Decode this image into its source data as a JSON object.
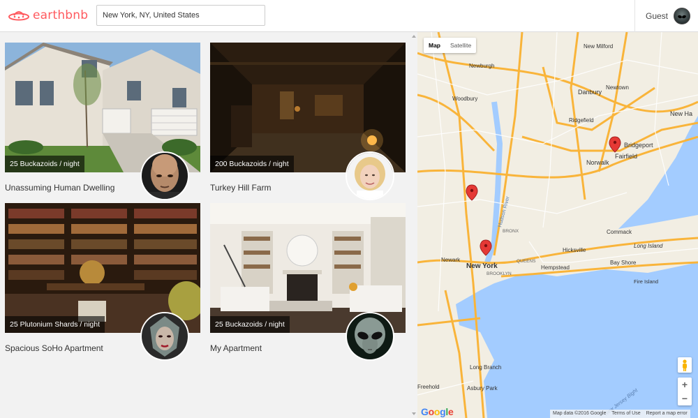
{
  "header": {
    "logo_text": "earthbnb",
    "search_value": "New York, NY, United States",
    "user_name": "Guest"
  },
  "listings": [
    {
      "price": "25 Buckazoids / night",
      "title": "Unassuming Human Dwelling",
      "photo": "house-photo",
      "host": "bald-alien-host"
    },
    {
      "price": "200 Buckazoids / night",
      "title": "Turkey Hill Farm",
      "photo": "dark-farm-interior-photo",
      "host": "blonde-woman-host"
    },
    {
      "price": "25 Plutonium Shards / night",
      "title": "Spacious SoHo Apartment",
      "photo": "library-photo",
      "host": "green-alien-host"
    },
    {
      "price": "25 Buckazoids / night",
      "title": "My Apartment",
      "photo": "living-room-photo",
      "host": "grey-alien-host"
    }
  ],
  "map": {
    "type_buttons": [
      "Map",
      "Satellite"
    ],
    "active_type": "Map",
    "zoom_in": "+",
    "zoom_out": "−",
    "attribution": [
      "Map data ©2016 Google",
      "Terms of Use",
      "Report a map error"
    ],
    "labels": {
      "new_milford": "New Milford",
      "newburgh": "Newburgh",
      "danbury": "Danbury",
      "newtown": "Newtown",
      "woodbury": "Woodbury",
      "ridgefield": "Ridgefield",
      "new_haven": "New Ha",
      "bridgeport": "Bridgeport",
      "norwalk": "Norwalk",
      "fairfield": "Fairfield",
      "hudson_river": "Hudson River",
      "bronx": "BRONX",
      "commack": "Commack",
      "newark": "Newark",
      "new_york": "New York",
      "queens": "QUEENS",
      "hicksville": "Hicksville",
      "long_island": "Long Island",
      "hempstead": "Hempstead",
      "bay_shore": "Bay Shore",
      "brooklyn": "BROOKLYN",
      "fire_island": "Fire Island",
      "long_branch": "Long Branch",
      "asbury_park": "Asbury Park",
      "freehold": "Freehold",
      "new_jersey_bight": "New Jersey Bight"
    },
    "colors": {
      "land": "#f2eee3",
      "water": "#a3ccff",
      "highway": "#f9b43a",
      "road": "#ffffff",
      "marker": "#e53935"
    }
  }
}
